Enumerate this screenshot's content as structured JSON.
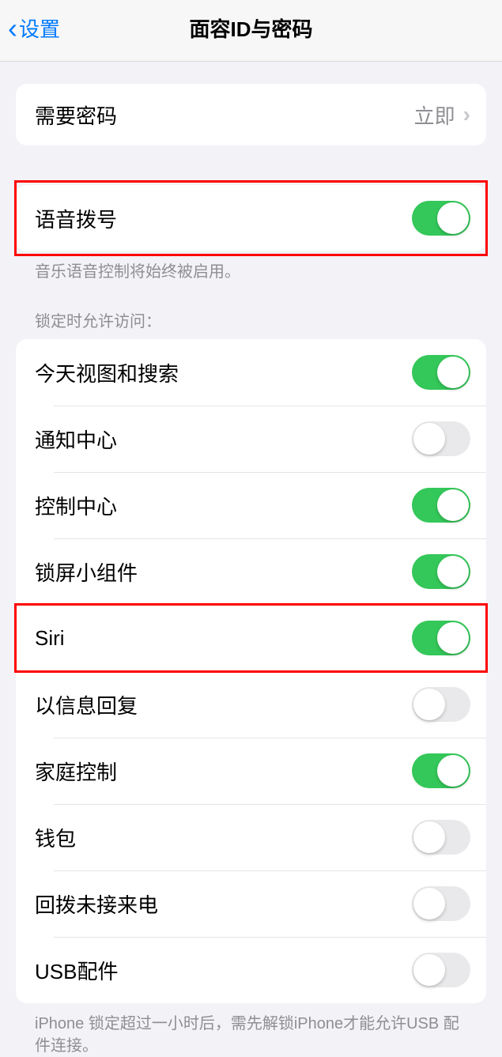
{
  "header": {
    "back_label": "设置",
    "title": "面容ID与密码"
  },
  "passcode_group": {
    "require_passcode": {
      "label": "需要密码",
      "value": "立即"
    }
  },
  "voice_dial_group": {
    "voice_dial": {
      "label": "语音拨号",
      "on": true
    },
    "footer": "音乐语音控制将始终被启用。"
  },
  "lock_access": {
    "header": "锁定时允许访问：",
    "items": [
      {
        "label": "今天视图和搜索",
        "on": true,
        "name": "today-view-search"
      },
      {
        "label": "通知中心",
        "on": false,
        "name": "notification-center"
      },
      {
        "label": "控制中心",
        "on": true,
        "name": "control-center"
      },
      {
        "label": "锁屏小组件",
        "on": true,
        "name": "lock-screen-widgets"
      },
      {
        "label": "Siri",
        "on": true,
        "name": "siri"
      },
      {
        "label": "以信息回复",
        "on": false,
        "name": "reply-messages"
      },
      {
        "label": "家庭控制",
        "on": true,
        "name": "home-control"
      },
      {
        "label": "钱包",
        "on": false,
        "name": "wallet"
      },
      {
        "label": "回拨未接来电",
        "on": false,
        "name": "return-missed-calls"
      },
      {
        "label": "USB配件",
        "on": false,
        "name": "usb-accessories"
      }
    ],
    "footer": "iPhone 锁定超过一小时后，需先解锁iPhone才能允许USB 配件连接。"
  }
}
